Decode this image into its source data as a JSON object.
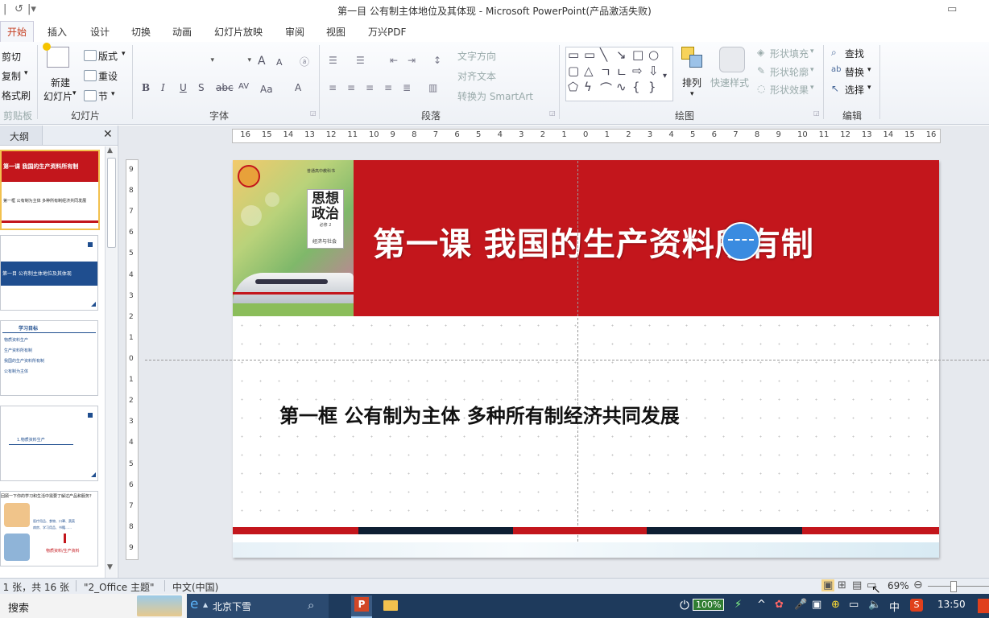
{
  "window": {
    "title": "第一目  公有制主体地位及其体现  -  Microsoft PowerPoint(产品激活失败)"
  },
  "tabs": [
    "开始",
    "插入",
    "设计",
    "切换",
    "动画",
    "幻灯片放映",
    "审阅",
    "视图",
    "万兴PDF"
  ],
  "ribbon": {
    "clipboard": {
      "cut": "剪切",
      "copy": "复制",
      "format": "格式刷",
      "group": "剪贴板"
    },
    "slides": {
      "new_line1": "新建",
      "new_line2": "幻灯片",
      "layout": "版式",
      "reset": "重设",
      "section": "节",
      "group": "幻灯片"
    },
    "font": {
      "group": "字体",
      "size_up": "A",
      "size_down": "A",
      "bold": "B",
      "italic": "I",
      "underline": "U",
      "shadow": "S",
      "strike": "abc",
      "spacing": "AV",
      "case": "Aa",
      "color": "A"
    },
    "paragraph": {
      "text_dir": "文字方向",
      "align_text": "对齐文本",
      "smartart": "转换为 SmartArt",
      "group": "段落"
    },
    "drawing": {
      "arrange": "排列",
      "quick_styles": "快速样式",
      "fill": "形状填充",
      "outline": "形状轮廓",
      "effects": "形状效果",
      "group": "绘图"
    },
    "editing": {
      "find": "查找",
      "replace": "替换",
      "select": "选择",
      "group": "编辑"
    }
  },
  "outline_pane": {
    "tab_label": "大纲",
    "close": "✕"
  },
  "thumbnails": [
    {
      "num": "1",
      "title": "第一课  我国的生产资料所有制",
      "sub": "第一框 公有制为主体 多种所有制经济共同发展"
    },
    {
      "num": "2",
      "title": "第一目  公有制主体地位及其体现"
    },
    {
      "num": "3",
      "title": "学习目标",
      "items": [
        "物质资料生产",
        "生产资料所有制",
        "我国的生产资料所有制",
        "公有制为主体"
      ]
    },
    {
      "num": "4",
      "title": "1.物质资料生产"
    },
    {
      "num": "5",
      "title": "回顾一下你的学习和生活中需要了解过产品和服务？",
      "labels": [
        "医疗用品、食物、口罩、蔬菜",
        "病房、学习用品、书籍……",
        "物质资料/生产资料"
      ]
    }
  ],
  "ruler": {
    "h_ticks": [
      "16",
      "15",
      "14",
      "13",
      "12",
      "11",
      "10",
      "9",
      "8",
      "7",
      "6",
      "5",
      "4",
      "3",
      "2",
      "1",
      "0",
      "1",
      "2",
      "3",
      "4",
      "5",
      "6",
      "7",
      "8",
      "9",
      "10",
      "11",
      "12",
      "13",
      "14",
      "15",
      "16"
    ],
    "v_ticks": [
      "9",
      "8",
      "7",
      "6",
      "5",
      "4",
      "3",
      "2",
      "1",
      "0",
      "1",
      "2",
      "3",
      "4",
      "5",
      "6",
      "7",
      "8",
      "9"
    ]
  },
  "slide": {
    "title": "第一课   我国的生产资料所有制",
    "subtitle": "第一框  公有制为主体  多种所有制经济共同发展",
    "book": {
      "line1": "思想",
      "line2": "政治",
      "series": "普通高中教科书",
      "vol": "必修 2",
      "sub": "经济与社会"
    },
    "colors": {
      "red": "#c3161c",
      "navy": "#0e1f33"
    }
  },
  "status": {
    "slide_info": "幻灯片 第 1 张，共 16 张",
    "theme": "\"2_Office 主题\"",
    "lang": "中文(中国)",
    "zoom": "69%"
  },
  "taskbar": {
    "search": "搜索",
    "weather": "北京下雪",
    "battery": "100%",
    "ime": "中",
    "time": "13:50"
  }
}
